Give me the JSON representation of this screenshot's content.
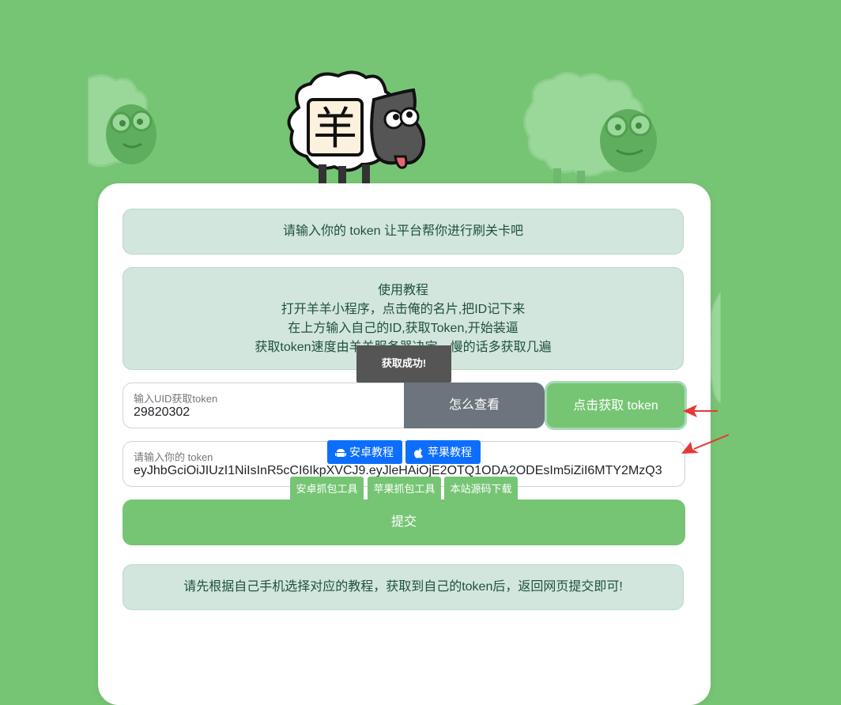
{
  "notice_top": "请输入你的 token 让平台帮你进行刷关卡吧",
  "tutorial": {
    "title": "使用教程",
    "line1": "打开羊羊小程序，点击俺的名片,把ID记下来",
    "line2": "在上方输入自己的ID,获取Token,开始装逼",
    "line3": "获取token速度由羊羊服务器决定，慢的话多获取几遍"
  },
  "uid_field": {
    "label": "输入UID获取token",
    "value": "29820302"
  },
  "how_button": "怎么查看",
  "get_token_button": "点击获取 token",
  "token_field": {
    "label": "请输入你的 token",
    "value": "eyJhbGciOiJIUzI1NiIsInR5cCI6IkpXVCJ9.eyJleHAiOjE2OTQ1ODA2ODEsIm5iZiI6MTY2MzQ3"
  },
  "submit_button": "提交",
  "toast": "获取成功!",
  "notice_bottom": "请先根据自己手机选择对应的教程，获取到自己的token后，返回网页提交即可!",
  "tutorial_buttons": {
    "android": "安卓教程",
    "apple": "苹果教程"
  },
  "tool_buttons": {
    "android_tool": "安卓抓包工具",
    "apple_tool": "苹果抓包工具",
    "source": "本站源码下载"
  },
  "logo_text": "羊",
  "colors": {
    "background": "#76c574",
    "alert_bg": "#d2e6de",
    "secondary": "#6c757d",
    "primary": "#0d6efd"
  }
}
